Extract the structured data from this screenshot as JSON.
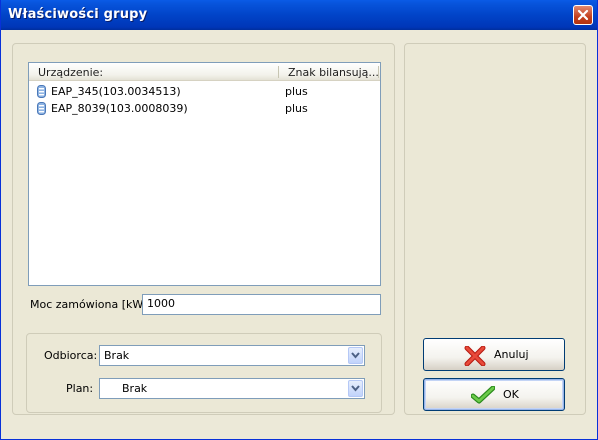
{
  "window": {
    "title": "Właściwości grupy"
  },
  "devices_list": {
    "columns": [
      "Urządzenie:",
      "Znak bilansują..."
    ],
    "rows": [
      {
        "device": "EAP_345(103.0034513)",
        "sign": "plus"
      },
      {
        "device": "EAP_8039(103.0008039)",
        "sign": "plus"
      }
    ]
  },
  "ordered_power": {
    "label": "Moc zamówiona [kW]:",
    "value": "1000"
  },
  "recipient": {
    "label": "Odbiorca:",
    "value": "Brak"
  },
  "plan": {
    "label": "Plan:",
    "value": "Brak"
  },
  "buttons": {
    "cancel": "Anuluj",
    "ok": "OK"
  },
  "colors": {
    "title_bar": "#0144C8",
    "dialog_bg": "#ECE9D8",
    "cancel_icon": "#D8261A",
    "ok_icon": "#3BA826"
  }
}
